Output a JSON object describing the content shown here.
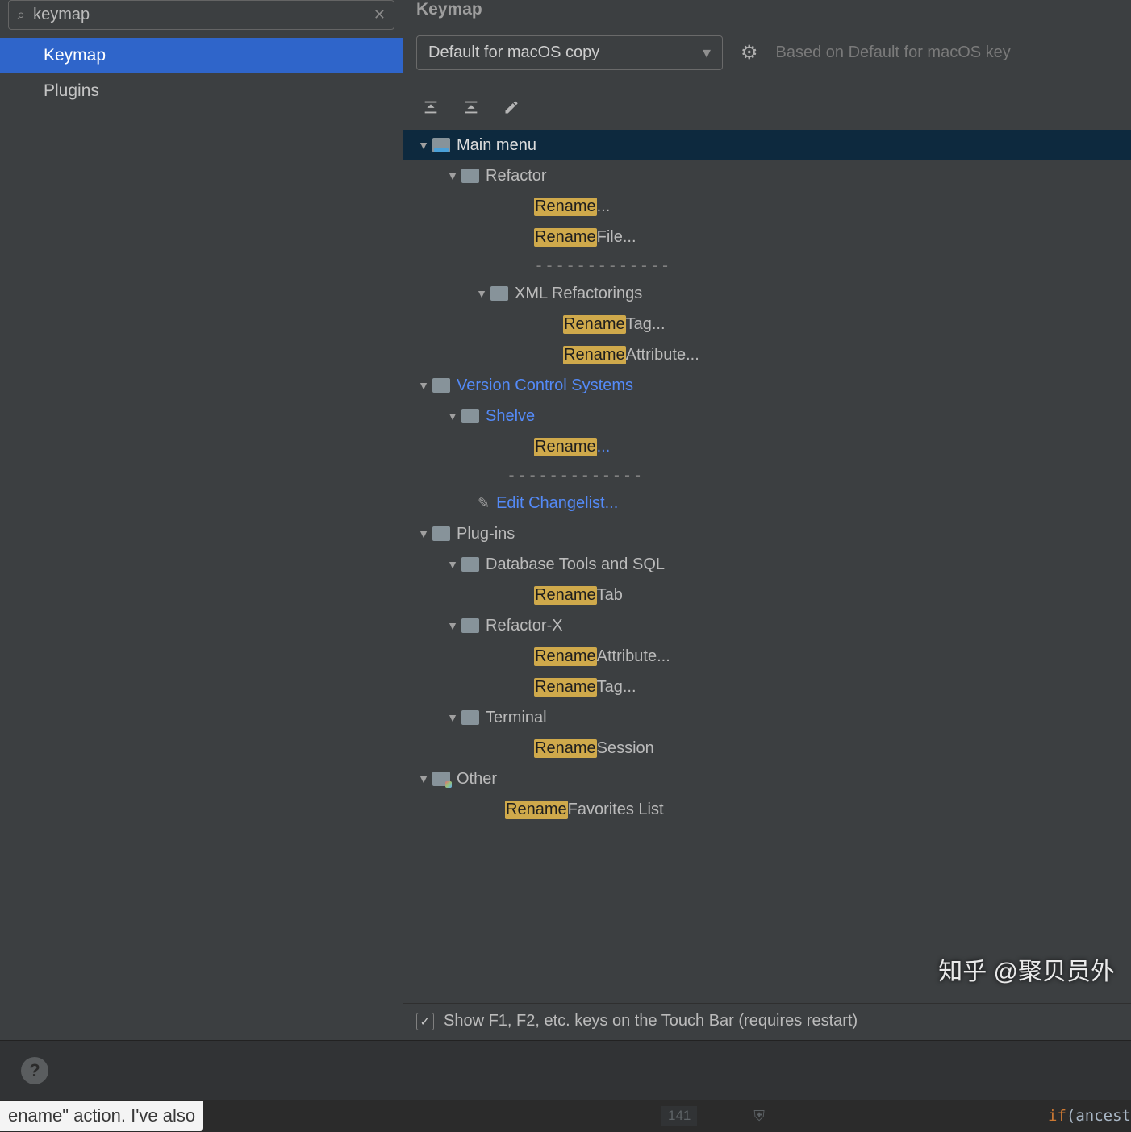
{
  "search": {
    "value": "keymap"
  },
  "sidebar": {
    "items": [
      {
        "label": "Keymap",
        "selected": true
      },
      {
        "label": "Plugins",
        "selected": false
      }
    ]
  },
  "main": {
    "title": "Keymap",
    "scheme_dropdown": "Default for macOS copy",
    "based_text": "Based on Default for macOS key",
    "tree": {
      "main_menu": "Main menu",
      "refactor": "Refactor",
      "rename_action": "Rename",
      "rename_ellipsis": "...",
      "rename_file_text": " File...",
      "xml_refactorings": "XML Refactorings",
      "tag_text": " Tag...",
      "attribute_text": " Attribute...",
      "vcs": "Version Control Systems",
      "shelve": "Shelve",
      "edit_changelist": "Edit Changelist...",
      "plugins": "Plug-ins",
      "db_tools": "Database Tools and SQL",
      "tab_text": " Tab",
      "refactor_x": "Refactor-X",
      "terminal": "Terminal",
      "session_text": " Session",
      "other": "Other",
      "favorites_text": " Favorites List",
      "dashes": "-------------"
    },
    "footer_checkbox": "Show F1, F2, etc. keys on the Touch Bar (requires restart)"
  },
  "watermark": "知乎 @聚贝员外",
  "codebar": {
    "snippet": "ename\" action. I've also",
    "lineno": "141",
    "if_kw": "if",
    "rest": "(ancest"
  }
}
